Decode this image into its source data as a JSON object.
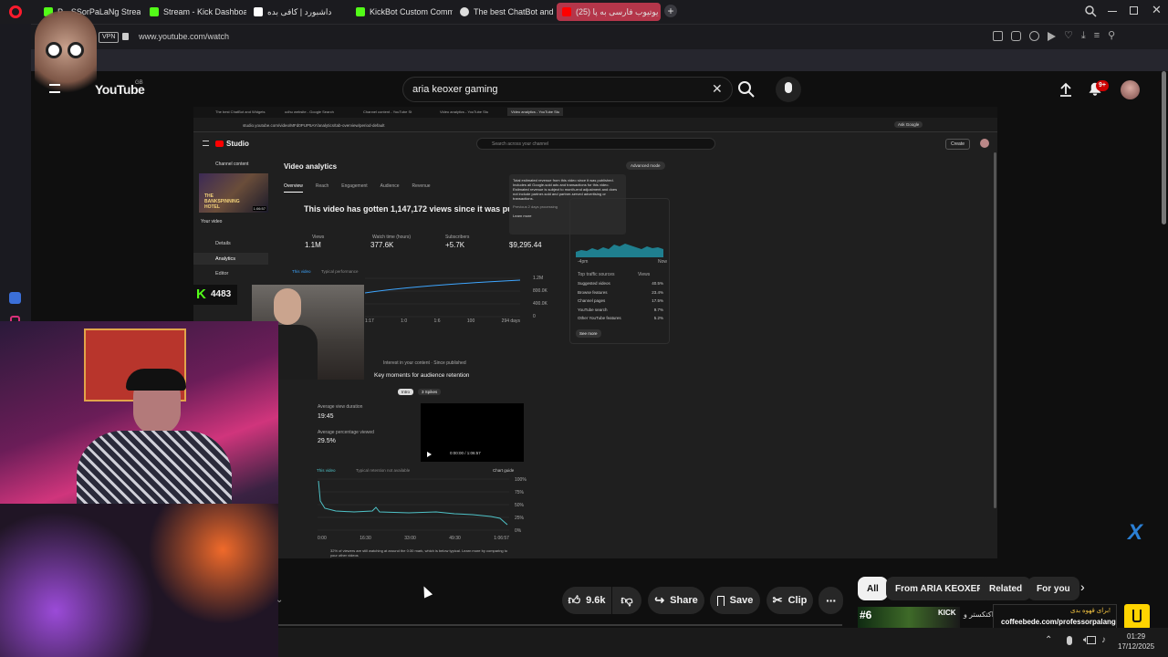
{
  "browser": {
    "tabs": [
      {
        "label": "P... SSorPaLaNg Stream",
        "color": "#53fc18"
      },
      {
        "label": "Stream - Kick Dashboard",
        "color": "#53fc18"
      },
      {
        "label": "داشبورد | کافی بده",
        "color": "#ffffff"
      },
      {
        "label": "KickBot Custom Comman",
        "color": "#53fc18"
      },
      {
        "label": "The best ChatBot and Wid",
        "color": "#dddddd"
      },
      {
        "label": "(25) آیا یوتیوب فارسی به پا",
        "color": "#ff0000"
      }
    ],
    "vpn": "VPN",
    "url": "www.youtube.com/watch"
  },
  "youtube": {
    "logo": "YouTube",
    "logo_region": "GB",
    "search_query": "aria keoxer gaming",
    "notif_count": "9+"
  },
  "studio": {
    "tabs": [
      "The best ChatBot and Widgets",
      "udhu website - Google Search",
      "Channel content - YouTube St",
      "Video analytics - YouTube Stu",
      "Video analytics - YouTube Stu"
    ],
    "url": "studio.youtube.com/video/MFd0PUP5AY/analytics/tab-overview/period-default",
    "ask_google": "Ask Google",
    "logo": "Studio",
    "search_placeholder": "Search across your channel",
    "create": "Create",
    "channel_content": "Channel content",
    "thumb_title": "THE BANKSPINNING HOTEL",
    "thumb_duration": "1:06:57",
    "your_video": "Your video",
    "nav": [
      "Details",
      "Analytics",
      "Editor"
    ],
    "page_title": "Video analytics",
    "advanced_mode": "Advanced mode",
    "subtabs": [
      "Overview",
      "Reach",
      "Engagement",
      "Audience",
      "Revenue"
    ],
    "headline": "This video has gotten 1,147,172 views since it was pu",
    "tooltip": "Total estimated revenue from this video since it was published. Includes all Google-sold ads and transactions for this video. Estimated revenue is subject to month-end adjustment and does not include partner-sold and partner-served advertising or transactions.",
    "tooltip_note": "Previous 2 days processing",
    "learn_more": "Learn more",
    "metrics": [
      {
        "label": "Views",
        "value": "1.1M"
      },
      {
        "label": "Watch time (hours)",
        "value": "377.6K"
      },
      {
        "label": "Subscribers",
        "value": "+5.7K"
      },
      {
        "label": "Estimated revenue",
        "value": "$9,295.44"
      }
    ],
    "legend_this": "This video",
    "legend_typical": "Typical performance",
    "yticks": [
      "1.2M",
      "800.0K",
      "400.0K",
      "0"
    ],
    "xticks": [
      "0",
      "1:17",
      "1:0",
      "1:6",
      "100",
      "294 days"
    ],
    "traffic_title": "Top traffic sources",
    "traffic_views": "Views",
    "traffic": [
      {
        "name": "Suggested videos",
        "pct": "40.5%"
      },
      {
        "name": "Browse features",
        "pct": "23.4%"
      },
      {
        "name": "Channel pages",
        "pct": "17.5%"
      },
      {
        "name": "YouTube search",
        "pct": "9.7%"
      },
      {
        "name": "Other YouTube features",
        "pct": "5.2%"
      }
    ],
    "see_more": "See more",
    "chart_xlabels": [
      "-4pm",
      "Now"
    ],
    "key_moments_sub": "Interest in your content · Since published",
    "key_moments": "Key moments for audience retention",
    "km_tabs": [
      "Intro",
      "3 Spikes"
    ],
    "avg_duration_label": "Average view duration",
    "avg_duration": "19:45",
    "avg_pct_label": "Average percentage viewed",
    "avg_pct": "29.5%",
    "player_time": "0:00:00 / 1:06:57",
    "ret_legend_this": "This video",
    "ret_legend_typical": "Typical retention not available",
    "chart_guide": "Chart guide",
    "ret_yticks": [
      "100%",
      "75%",
      "50%",
      "25%",
      "0%"
    ],
    "ret_xticks": [
      "0:00",
      "16:30",
      "33:00",
      "49:30",
      "1:06:57"
    ],
    "ret_note": "32% of viewers are still watching at around the 0:30 mark, which is below typical. Learn more by comparing to your other videos"
  },
  "kick": {
    "label": "K",
    "viewers": "4483"
  },
  "actions": {
    "likes": "9.6k",
    "share": "Share",
    "save": "Save",
    "clip": "Clip"
  },
  "chips": [
    "All",
    "From ARIA KEOXER",
    "Related",
    "For you"
  ],
  "promo": {
    "rank": "#6",
    "fa_line": "برای قهوه بدی!",
    "site": "coffeebede.com/professorpalang",
    "side_text": "اکتکستر و"
  },
  "taskbar": {
    "time": "01:29",
    "date": "17/12/2025"
  },
  "colors": {
    "accent_tab": "#b4364a",
    "kick_green": "#53fc18",
    "yt_red": "#ff0000",
    "chart_line": "#3ea6ff",
    "retention_line": "#4fc3c8"
  }
}
